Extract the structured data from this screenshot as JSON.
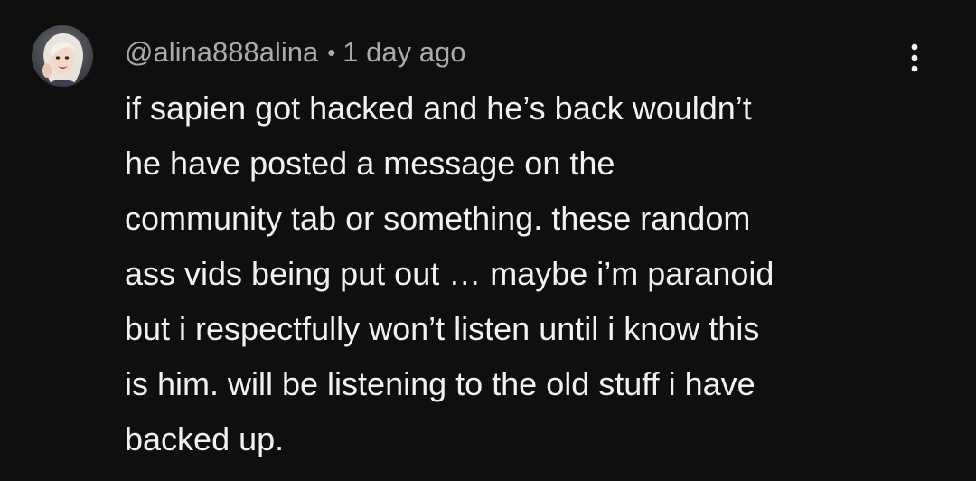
{
  "comment": {
    "avatar_icon": "user-avatar-icon",
    "author": "@alina888alina",
    "separator": "•",
    "timestamp": "1 day ago",
    "menu_icon": "more-vertical-icon",
    "text": "if sapien got hacked and he’s back wouldn’t\nhe have posted a message on the\ncommunity tab or something. these random\nass vids being put out … maybe i’m paranoid\nbut i respectfully won’t listen until i know this\nis him. will be listening to the old stuff i have\nbacked up."
  },
  "colors": {
    "background": "#0f0f0f",
    "primary_text": "#f1f1f1",
    "secondary_text": "#aaaaaa"
  }
}
